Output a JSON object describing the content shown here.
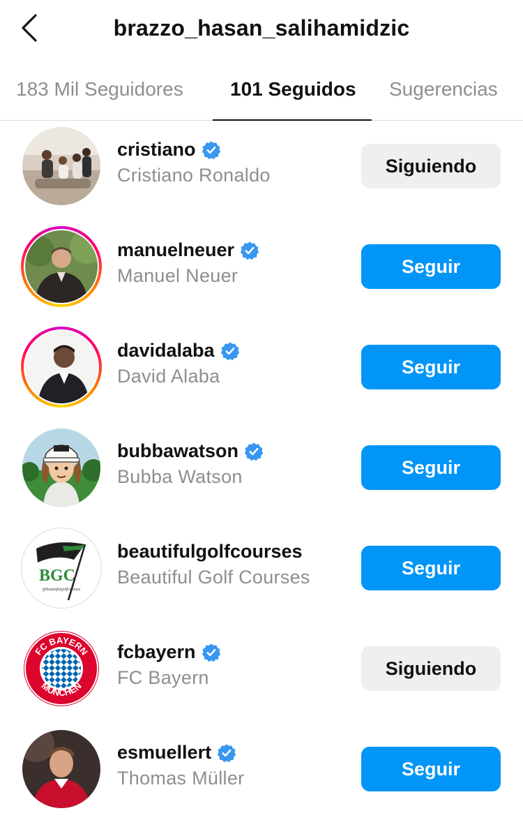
{
  "header": {
    "title": "brazzo_hasan_salihamidzic",
    "back_icon": "chevron-left-icon"
  },
  "tabs": [
    {
      "label": "183 Mil Seguidores",
      "active": false
    },
    {
      "label": "101 Seguidos",
      "active": true
    },
    {
      "label": "Sugerencias",
      "active": false
    }
  ],
  "accounts": [
    {
      "username": "cristiano",
      "full_name": "Cristiano Ronaldo",
      "verified": true,
      "story_ring": false,
      "button": "Siguiendo",
      "button_state": "following",
      "avatar_icon": "family-photo-avatar"
    },
    {
      "username": "manuelneuer",
      "full_name": "Manuel Neuer",
      "verified": true,
      "story_ring": true,
      "button": "Seguir",
      "button_state": "follow",
      "avatar_icon": "person-photo-avatar"
    },
    {
      "username": "davidalaba",
      "full_name": "David Alaba",
      "verified": true,
      "story_ring": true,
      "button": "Seguir",
      "button_state": "follow",
      "avatar_icon": "person-photo-avatar"
    },
    {
      "username": "bubbawatson",
      "full_name": "Bubba Watson",
      "verified": true,
      "story_ring": false,
      "button": "Seguir",
      "button_state": "follow",
      "avatar_icon": "cartoon-golfer-avatar"
    },
    {
      "username": "beautifulgolfcourses",
      "full_name": "Beautiful Golf Courses",
      "verified": false,
      "story_ring": false,
      "button": "Seguir",
      "button_state": "follow",
      "avatar_icon": "bgc-logo-avatar",
      "avatar_logo_text": "BGC",
      "avatar_logo_subtext": "@beautifulgolfcourses"
    },
    {
      "username": "fcbayern",
      "full_name": "FC Bayern",
      "verified": true,
      "story_ring": false,
      "button": "Siguiendo",
      "button_state": "following",
      "avatar_icon": "fc-bayern-crest-avatar"
    },
    {
      "username": "esmuellert",
      "full_name": "Thomas Müller",
      "verified": true,
      "story_ring": false,
      "button": "Seguir",
      "button_state": "follow",
      "avatar_icon": "person-photo-avatar"
    }
  ],
  "colors": {
    "follow_button": "#0095f6",
    "following_button": "#efefef",
    "verified_badge": "#3897f0",
    "secondary_text": "#8e8e8e"
  }
}
